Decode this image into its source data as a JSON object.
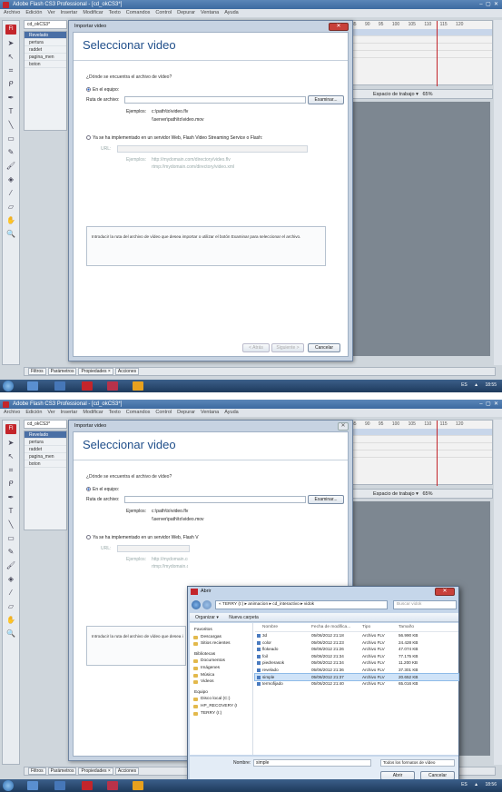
{
  "app": {
    "title": "Adobe Flash CS3 Professional - [cd_okCS3*]",
    "menu": [
      "Archivo",
      "Edición",
      "Ver",
      "Insertar",
      "Modificar",
      "Texto",
      "Comandos",
      "Control",
      "Depurar",
      "Ventana",
      "Ayuda"
    ],
    "doc_tab": "cd_okCS3*",
    "layers": [
      "Revelado",
      "pertura",
      "raddet",
      "pagina_men",
      "boton"
    ],
    "timeline_numbers": "85 90 95 100 105 110 115 120",
    "workspace": "Espacio de trabajo ▾",
    "zoom": "65%",
    "panels": [
      "Filtros",
      "Parámetros",
      "Propiedades ×",
      "Acciones"
    ],
    "clock_top": "18:55",
    "clock_bottom": "18:56",
    "tray": "ES ▲"
  },
  "wizard": {
    "window_title": "Importar video",
    "heading": "Seleccionar video",
    "question": "¿Dónde se encuentra el archivo de vídeo?",
    "opt_local": "En el equipo:",
    "path_label": "Ruta de archivo:",
    "browse": "Examinar...",
    "ex_label": "Ejemplos:",
    "ex1": "c:\\path\\to\\video.flv",
    "ex2": "\\\\server\\path\\to\\video.mov",
    "opt_web": "Ya se ha implementado en un servidor Web, Flash Video Streaming Service o Flash:",
    "url_label": "URL:",
    "web_ex_label": "Ejemplos:",
    "web_ex1": "http://mydomain.com/directory/video.flv",
    "web_ex2": "rtmp://mydomain.com/directory/video.xml",
    "info": "Introducir la ruta del archivo de vídeo que desea importar o utilizar el botón Examinar para seleccionar el archivo.",
    "info_short": "Introducir la ruta del archivo de vídeo que desea i",
    "back": "< Atrás",
    "next": "Siguiente >",
    "cancel": "Cancelar"
  },
  "abrir": {
    "title": "Abrir",
    "path": "« TERRY (I:) ▸ animacion ▸ cd_interactivo ▸ vidok",
    "search_placeholder": "Buscar vidok",
    "organize": "Organizar ▾",
    "new_folder": "Nueva carpeta",
    "nav": [
      {
        "label": "Favoritos",
        "header": true
      },
      {
        "label": "Descargas"
      },
      {
        "label": "Sitios recientes"
      },
      {
        "label": "Bibliotecas",
        "header": true
      },
      {
        "label": "Documentos"
      },
      {
        "label": "Imágenes"
      },
      {
        "label": "Música"
      },
      {
        "label": "Videos"
      },
      {
        "label": "Equipo",
        "header": true
      },
      {
        "label": "Disco local (C:)"
      },
      {
        "label": "HP_RECOVERY (I"
      },
      {
        "label": "TERRY (I:)"
      }
    ],
    "columns": [
      "Nombre",
      "Fecha de modifica...",
      "Tipo",
      "Tamaño"
    ],
    "files": [
      {
        "name": "3d",
        "date": "05/06/2012 21:18",
        "type": "Archivo FLV",
        "size": "56.990 KB"
      },
      {
        "name": "color",
        "date": "05/06/2012 21:23",
        "type": "Archivo FLV",
        "size": "24.428 KB"
      },
      {
        "name": "flokeado",
        "date": "05/06/2012 21:26",
        "type": "Archivo FLV",
        "size": "47.074 KB"
      },
      {
        "name": "foil",
        "date": "05/06/2012 21:34",
        "type": "Archivo FLV",
        "size": "77.175 KB"
      },
      {
        "name": "piedrerasok",
        "date": "05/06/2012 21:34",
        "type": "Archivo FLV",
        "size": "11.200 KB"
      },
      {
        "name": "revelado",
        "date": "05/06/2012 21:36",
        "type": "Archivo FLV",
        "size": "37.301 KB"
      },
      {
        "name": "simple",
        "date": "05/06/2012 21:37",
        "type": "Archivo FLV",
        "size": "20.652 KB",
        "selected": true
      },
      {
        "name": "termofijado",
        "date": "05/06/2012 21:40",
        "type": "Archivo FLV",
        "size": "65.016 KB"
      }
    ],
    "filename_label": "Nombre:",
    "filename_value": "simple",
    "filter": "Todos los formatos de vídeo",
    "open": "Abrir",
    "cancel": "Cancelar"
  }
}
